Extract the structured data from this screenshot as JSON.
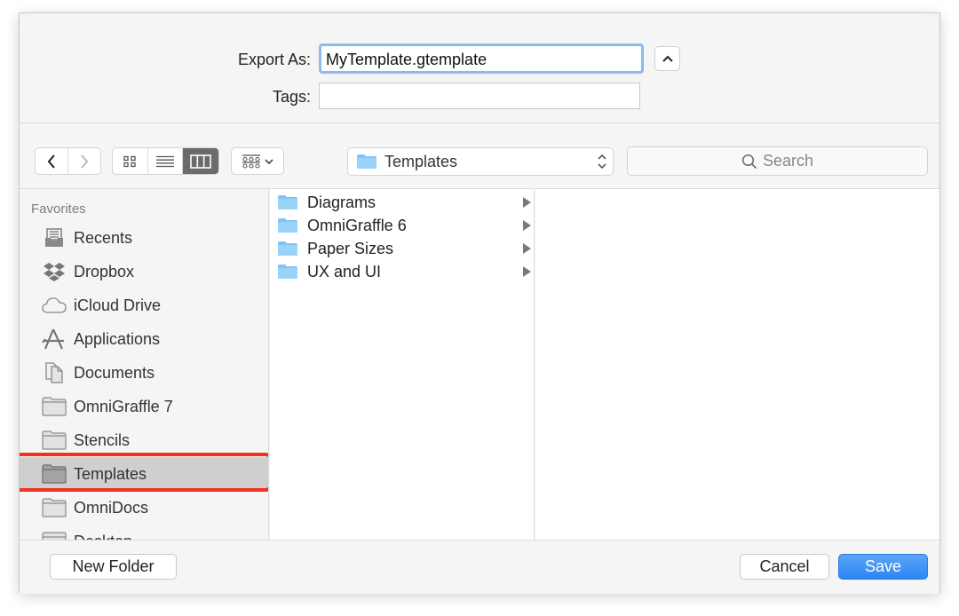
{
  "header": {
    "export_as_label": "Export As:",
    "export_as_value": "MyTemplate.gtemplate",
    "tags_label": "Tags:",
    "tags_value": ""
  },
  "toolbar": {
    "back_icon": "chevron-left-icon",
    "forward_icon": "chevron-right-icon",
    "view_modes": [
      "icon",
      "list",
      "column"
    ],
    "active_view": "column",
    "path_popup_value": "Templates",
    "search_placeholder": "Search"
  },
  "sidebar": {
    "section_title": "Favorites",
    "items": [
      {
        "label": "Recents",
        "icon": "recents-icon"
      },
      {
        "label": "Dropbox",
        "icon": "dropbox-icon"
      },
      {
        "label": "iCloud Drive",
        "icon": "icloud-icon"
      },
      {
        "label": "Applications",
        "icon": "applications-icon"
      },
      {
        "label": "Documents",
        "icon": "documents-icon"
      },
      {
        "label": "OmniGraffle 7",
        "icon": "folder-icon"
      },
      {
        "label": "Stencils",
        "icon": "folder-icon"
      },
      {
        "label": "Templates",
        "icon": "folder-icon",
        "selected": true
      },
      {
        "label": "OmniDocs",
        "icon": "folder-icon"
      },
      {
        "label": "Desktop",
        "icon": "folder-icon"
      }
    ]
  },
  "browser": {
    "column1": [
      {
        "name": "Diagrams"
      },
      {
        "name": "OmniGraffle 6"
      },
      {
        "name": "Paper Sizes"
      },
      {
        "name": "UX and UI"
      }
    ]
  },
  "footer": {
    "new_folder_label": "New Folder",
    "cancel_label": "Cancel",
    "save_label": "Save"
  },
  "colors": {
    "accent": "#2c86f2",
    "focus_ring": "#8cbaf0",
    "highlight_annotation": "#f0321e"
  }
}
